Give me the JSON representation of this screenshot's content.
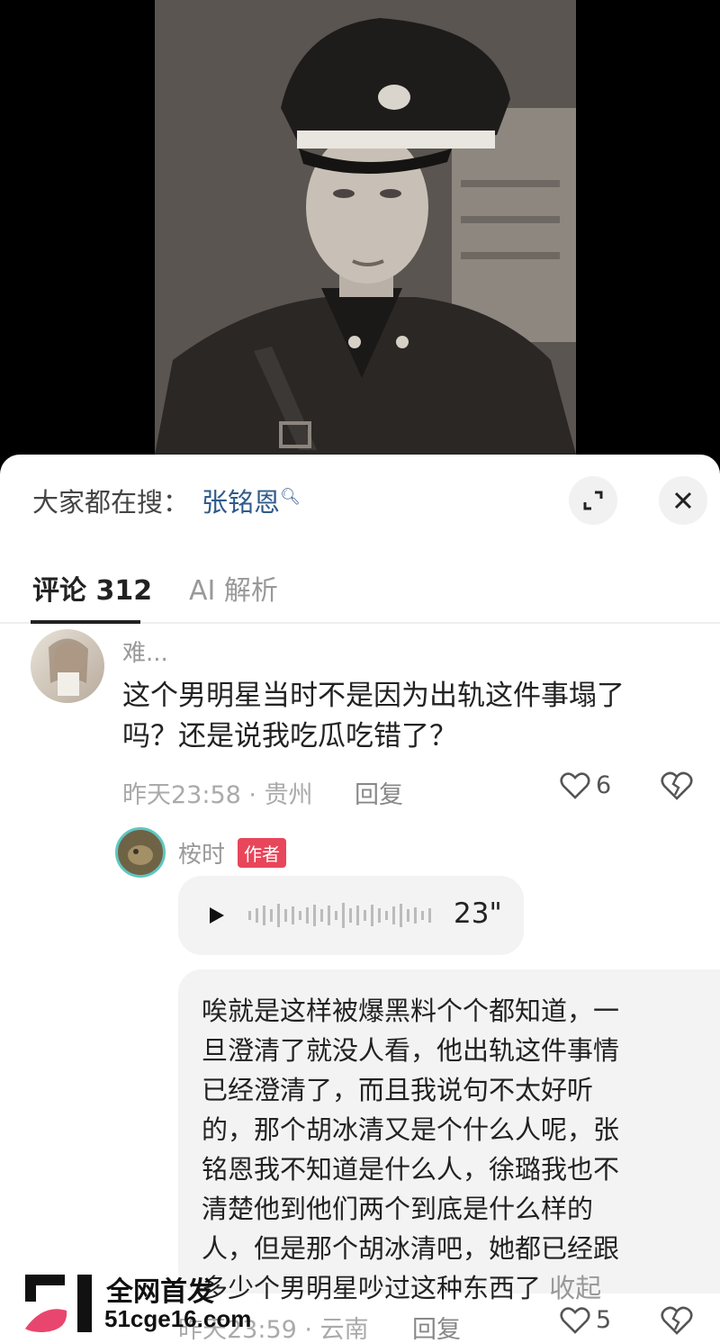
{
  "panel": {
    "search_label": "大家都在搜：",
    "search_term": "张铭恩"
  },
  "tabs": [
    {
      "label": "评论 312",
      "active": true
    },
    {
      "label": "AI 解析",
      "active": false
    }
  ],
  "comments": [
    {
      "user": "难...",
      "text_lines": [
        "这个男明星当时不是因为出轨这件事塌了",
        "吗？还是说我吃瓜吃错了？"
      ],
      "time": "昨天23:58",
      "location": "贵州",
      "reply_label": "回复",
      "likes": "6"
    }
  ],
  "reply": {
    "user": "桉时",
    "badge": "作者",
    "voice_duration": "23\"",
    "text_lines": [
      "唉就是这样被爆黑料个个都知道，一",
      "旦澄清了就没人看，他出轨这件事情",
      "已经澄清了，而且我说句不太好听",
      "的，那个胡冰清又是个什么人呢，张",
      "铭恩我不知道是什么人，徐璐我也不",
      "清楚他到他们两个到底是什么样的",
      "人，但是那个胡冰清吧，她都已经跟",
      "多少个男明星吵过这种东西了"
    ],
    "collapse_label": "收起",
    "time": "昨天23:59",
    "location": "云南",
    "reply_label": "回复",
    "likes": "5"
  },
  "watermark": {
    "line1": "全网首发",
    "line2": "51cge16.com"
  },
  "colors": {
    "author_badge": "#e8465a",
    "search_term": "#2f5b8a",
    "watermark_pink": "#e8466e"
  }
}
